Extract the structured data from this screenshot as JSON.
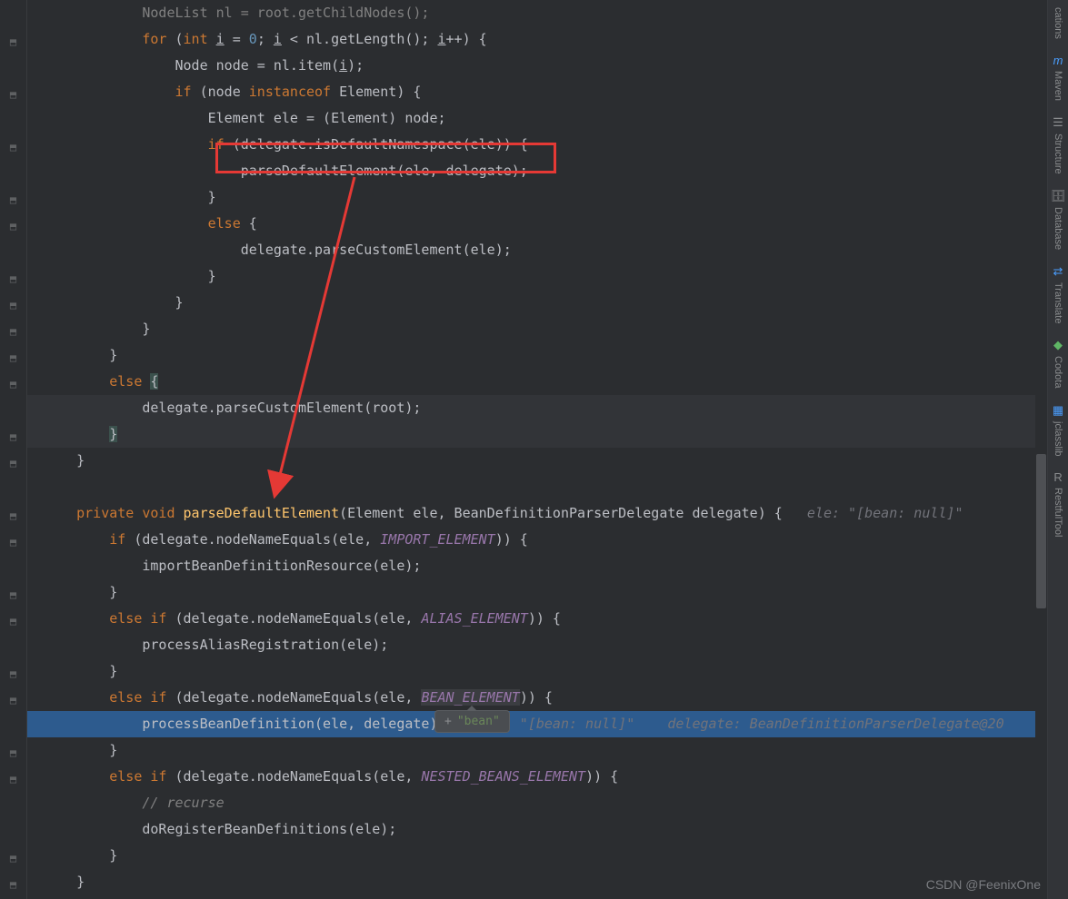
{
  "code": {
    "l0": "            NodeList nl = root.getChildNodes();",
    "l1_for": "for",
    "l1_int": "int",
    "l1_i": "i",
    "l1_eq": " = ",
    "l1_zero": "0",
    "l1_semi1": "; ",
    "l1_i2": "i",
    "l1_lt": " < nl.getLength(); ",
    "l1_i3": "i",
    "l1_pp": "++) {",
    "l2_node": "Node node = nl.item(",
    "l2_i": "i",
    "l2_end": ");",
    "l3_if": "if",
    "l3_cond": " (node ",
    "l3_inst": "instanceof",
    "l3_elem": " Element) {",
    "l4": "Element ele = (Element) node;",
    "l5_if": "if",
    "l5_cond": " (delegate.isDefaultNamespace(ele)) {",
    "l6": "parseDefaultElement(ele, delegate);",
    "l7": "}",
    "l8_else": "else",
    "l8_brace": " {",
    "l9": "delegate.parseCustomElement(ele);",
    "l10": "}",
    "l11": "}",
    "l12": "}",
    "l13": "}",
    "l14_else": "else",
    "l14_brace": " {",
    "l15": "delegate.parseCustomElement(root);",
    "l16": "}",
    "l17": "}",
    "l19_private": "private",
    "l19_void": " void ",
    "l19_method": "parseDefaultElement",
    "l19_params": "(Element ele, BeanDefinitionParserDelegate delegate) {",
    "l19_hint": "ele: \"[bean: null]\"",
    "l20_if": "if",
    "l20_cond1": " (delegate.nodeNameEquals(ele, ",
    "l20_const": "IMPORT_ELEMENT",
    "l20_cond2": ")) {",
    "l21": "importBeanDefinitionResource(ele);",
    "l22": "}",
    "l23_else": "else if",
    "l23_cond1": " (delegate.nodeNameEquals(ele, ",
    "l23_const": "ALIAS_ELEMENT",
    "l23_cond2": ")) {",
    "l24": "processAliasRegistration(ele);",
    "l25": "}",
    "l26_else": "else if",
    "l26_cond1": " (delegate.nodeNameEquals(ele, ",
    "l26_const": "BEAN_ELEMENT",
    "l26_cond2": ")) {",
    "l27_call": "processBeanDefinition(ele, delegate)",
    "l27_hint1": "\"[bean: null]\"",
    "l27_hint2": "delegate: BeanDefinitionParserDelegate@20",
    "l28": "}",
    "l29_else": "else if",
    "l29_cond1": " (delegate.nodeNameEquals(ele, ",
    "l29_const": "NESTED_BEANS_ELEMENT",
    "l29_cond2": ")) {",
    "l30_comment": "// recurse",
    "l31": "doRegisterBeanDefinitions(ele);",
    "l32": "}",
    "l33": "}"
  },
  "tooltip": {
    "plus": "+",
    "text": "\"bean\""
  },
  "sidebar": {
    "items": [
      {
        "label": "cations",
        "icon": "🔔"
      },
      {
        "label": "Maven",
        "icon": "m"
      },
      {
        "label": "Structure",
        "icon": "☰"
      },
      {
        "label": "Database",
        "icon": "🗄"
      },
      {
        "label": "Translate",
        "icon": "⇄"
      },
      {
        "label": "Codota",
        "icon": "◆"
      },
      {
        "label": "jclasslib",
        "icon": "▦"
      },
      {
        "label": "RestfulTool",
        "icon": "R"
      }
    ]
  },
  "watermark": "CSDN @FeenixOne"
}
